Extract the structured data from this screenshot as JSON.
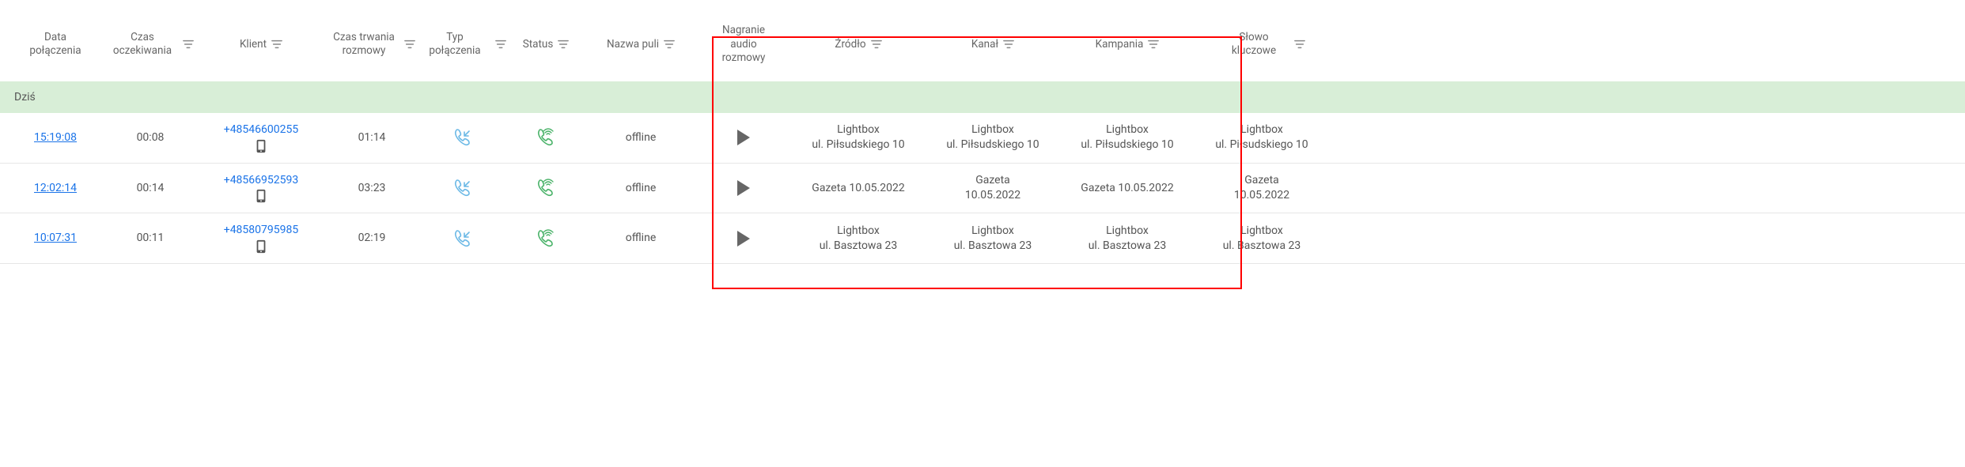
{
  "columns": [
    {
      "label": "Data połączenia",
      "filter": false
    },
    {
      "label": "Czas oczekiwania",
      "filter": true
    },
    {
      "label": "Klient",
      "filter": true
    },
    {
      "label": "Czas trwania rozmowy",
      "filter": true
    },
    {
      "label": "Typ połączenia",
      "filter": true
    },
    {
      "label": "Status",
      "filter": true
    },
    {
      "label": "Nazwa puli",
      "filter": true
    },
    {
      "label": "Nagranie audio rozmowy",
      "filter": false
    },
    {
      "label": "Źródło",
      "filter": true
    },
    {
      "label": "Kanał",
      "filter": true
    },
    {
      "label": "Kampania",
      "filter": true
    },
    {
      "label": "Słowo kluczowe",
      "filter": true
    }
  ],
  "group_label": "Dziś",
  "rows": [
    {
      "time": "15:19:08",
      "wait": "00:08",
      "client": "+48546600255",
      "duration": "01:14",
      "pool": "offline",
      "source_l1": "Lightbox",
      "source_l2": "ul. Piłsudskiego 10",
      "channel_l1": "Lightbox",
      "channel_l2": "ul. Piłsudskiego 10",
      "campaign_l1": "Lightbox",
      "campaign_l2": "ul. Piłsudskiego 10",
      "keyword_l1": "Lightbox",
      "keyword_l2": "ul. Piłsudskiego 10"
    },
    {
      "time": "12:02:14",
      "wait": "00:14",
      "client": "+48566952593",
      "duration": "03:23",
      "pool": "offline",
      "source_l1": "Gazeta 10.05.2022",
      "source_l2": "",
      "channel_l1": "Gazeta",
      "channel_l2": "10.05.2022",
      "campaign_l1": "Gazeta 10.05.2022",
      "campaign_l2": "",
      "keyword_l1": "Gazeta",
      "keyword_l2": "10.05.2022"
    },
    {
      "time": "10:07:31",
      "wait": "00:11",
      "client": "+48580795985",
      "duration": "02:19",
      "pool": "offline",
      "source_l1": "Lightbox",
      "source_l2": "ul. Basztowa 23",
      "channel_l1": "Lightbox",
      "channel_l2": "ul. Basztowa 23",
      "campaign_l1": "Lightbox",
      "campaign_l2": "ul. Basztowa 23",
      "keyword_l1": "Lightbox",
      "keyword_l2": "ul. Basztowa 23"
    }
  ]
}
